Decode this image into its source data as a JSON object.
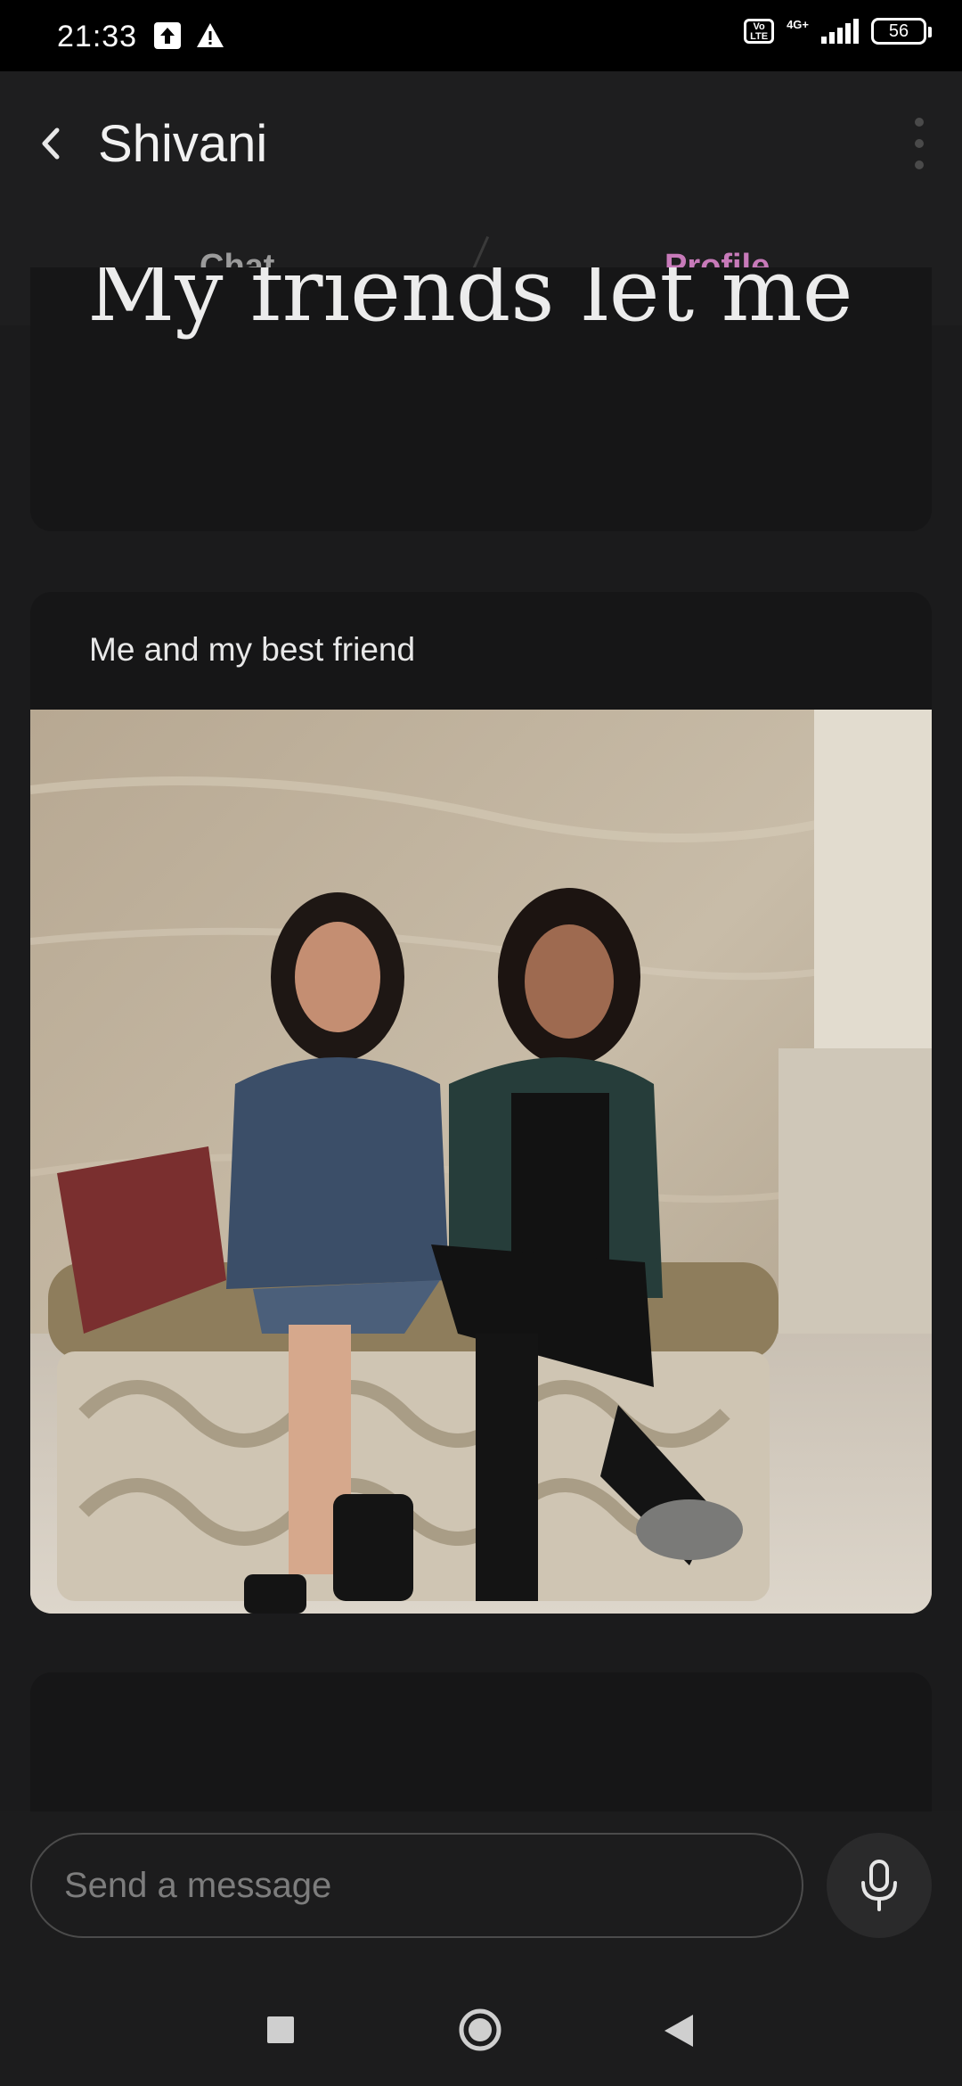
{
  "status_bar": {
    "time": "21:33",
    "left_icons": [
      "upload-icon",
      "warning-icon"
    ],
    "volte_label": "Vo\nLTE",
    "network": "4G+",
    "battery": "56"
  },
  "header": {
    "title": "Shivani",
    "back_icon": "chevron-left-icon",
    "menu_icon": "more-vertical-icon"
  },
  "tabs": [
    {
      "label": "Chat",
      "active": false
    },
    {
      "label": "Profile",
      "active": true
    }
  ],
  "cards": {
    "top_text": "My friends let me",
    "photo_caption": "Me and my best friend"
  },
  "composer": {
    "placeholder": "Send a message",
    "mic_icon": "microphone-icon"
  },
  "nav": {
    "recent_icon": "square-icon",
    "home_icon": "circle-icon",
    "back_icon": "triangle-back-icon"
  },
  "colors": {
    "accent": "#c77ab9",
    "accent_underline": "#8e3b7f",
    "background": "#1b1b1c",
    "card": "#161617"
  }
}
